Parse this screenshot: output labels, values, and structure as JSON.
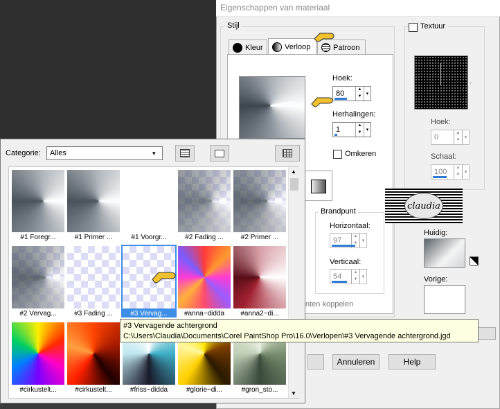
{
  "dialog": {
    "title": "Eigenschappen van materiaal",
    "style_group": "Stijl",
    "tabs": [
      {
        "label": "Kleur",
        "icon": "color-icon"
      },
      {
        "label": "Verloop",
        "icon": "gradient-icon"
      },
      {
        "label": "Patroon",
        "icon": "pattern-icon"
      }
    ],
    "angle_label": "Hoek:",
    "angle_value": "80",
    "repeats_label": "Herhalingen:",
    "repeats_value": "1",
    "invert_label": "Omkeren",
    "focal_group": "Brandpunt",
    "horizontal_label": "Horizontaal:",
    "horizontal_value": "97",
    "vertical_label": "Verticaal:",
    "vertical_value": "54",
    "link_label": "nten koppelen",
    "texture_label": "Textuur",
    "texture_angle_label": "Hoek:",
    "texture_angle_value": "0",
    "scale_label": "Schaal:",
    "scale_value": "100",
    "current_label": "Huidig:",
    "previous_label": "Vorige:",
    "cancel_label": "Annuleren",
    "help_label": "Help",
    "watermark_text": "claudia"
  },
  "picker": {
    "category_label": "Categorie:",
    "category_value": "Alles",
    "items": [
      {
        "caption": "#1 Foregr..."
      },
      {
        "caption": "#1 Primer ..."
      },
      {
        "caption": "#1 Voorgr..."
      },
      {
        "caption": "#2 Fading ..."
      },
      {
        "caption": "#2 Primer ..."
      },
      {
        "caption": "#2 Vervag..."
      },
      {
        "caption": "#3 Fading ..."
      },
      {
        "caption": "#3 Vervag..."
      },
      {
        "caption": "#anna~didda"
      },
      {
        "caption": "#anna2~di..."
      },
      {
        "caption": "#cirkustelt..."
      },
      {
        "caption": "#cirkustelt..."
      },
      {
        "caption": "#friss~didda"
      },
      {
        "caption": "#glorie~di..."
      },
      {
        "caption": "#gron_sto..."
      }
    ],
    "tooltip_title": "#3 Vervagende achtergrond",
    "tooltip_path": "C:\\Users\\Claudia\\Documents\\Corel PaintShop Pro\\16.0\\Verlopen\\#3 Vervagende achtergrond.jgd"
  }
}
